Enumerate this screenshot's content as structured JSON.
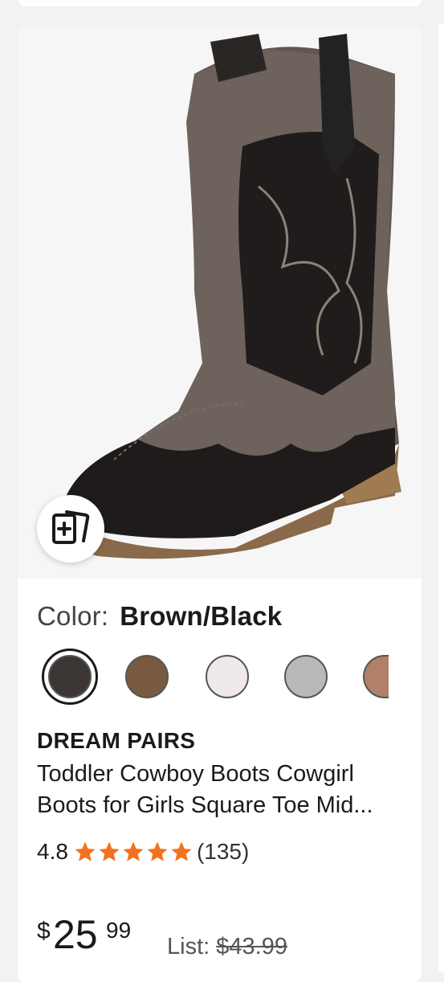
{
  "product": {
    "color_label": "Color:",
    "color_value": "Brown/Black",
    "swatches": [
      {
        "name": "Brown/Black",
        "color": "#3b3533",
        "selected": true
      },
      {
        "name": "Tan/Wood",
        "color": "#7a5a3e",
        "selected": false
      },
      {
        "name": "White",
        "color": "#efe9e9",
        "selected": false
      },
      {
        "name": "Silver",
        "color": "#b9b9b9",
        "selected": false
      },
      {
        "name": "Light Brown",
        "color": "#b08068",
        "selected": false
      }
    ],
    "brand": "DREAM PAIRS",
    "title": "Toddler Cowboy Boots Cowgirl Boots for Girls Square Toe Mid...",
    "rating": "4.8",
    "stars": 5,
    "review_count": "(135)",
    "price": {
      "symbol": "$",
      "dollars": "25",
      "cents": "99"
    },
    "list_label": "List:",
    "list_price": "$43.99"
  },
  "colors": {
    "star": "#f2711c",
    "text": "#1a1a1a"
  },
  "icons": {
    "ar": "view-in-room-icon"
  }
}
